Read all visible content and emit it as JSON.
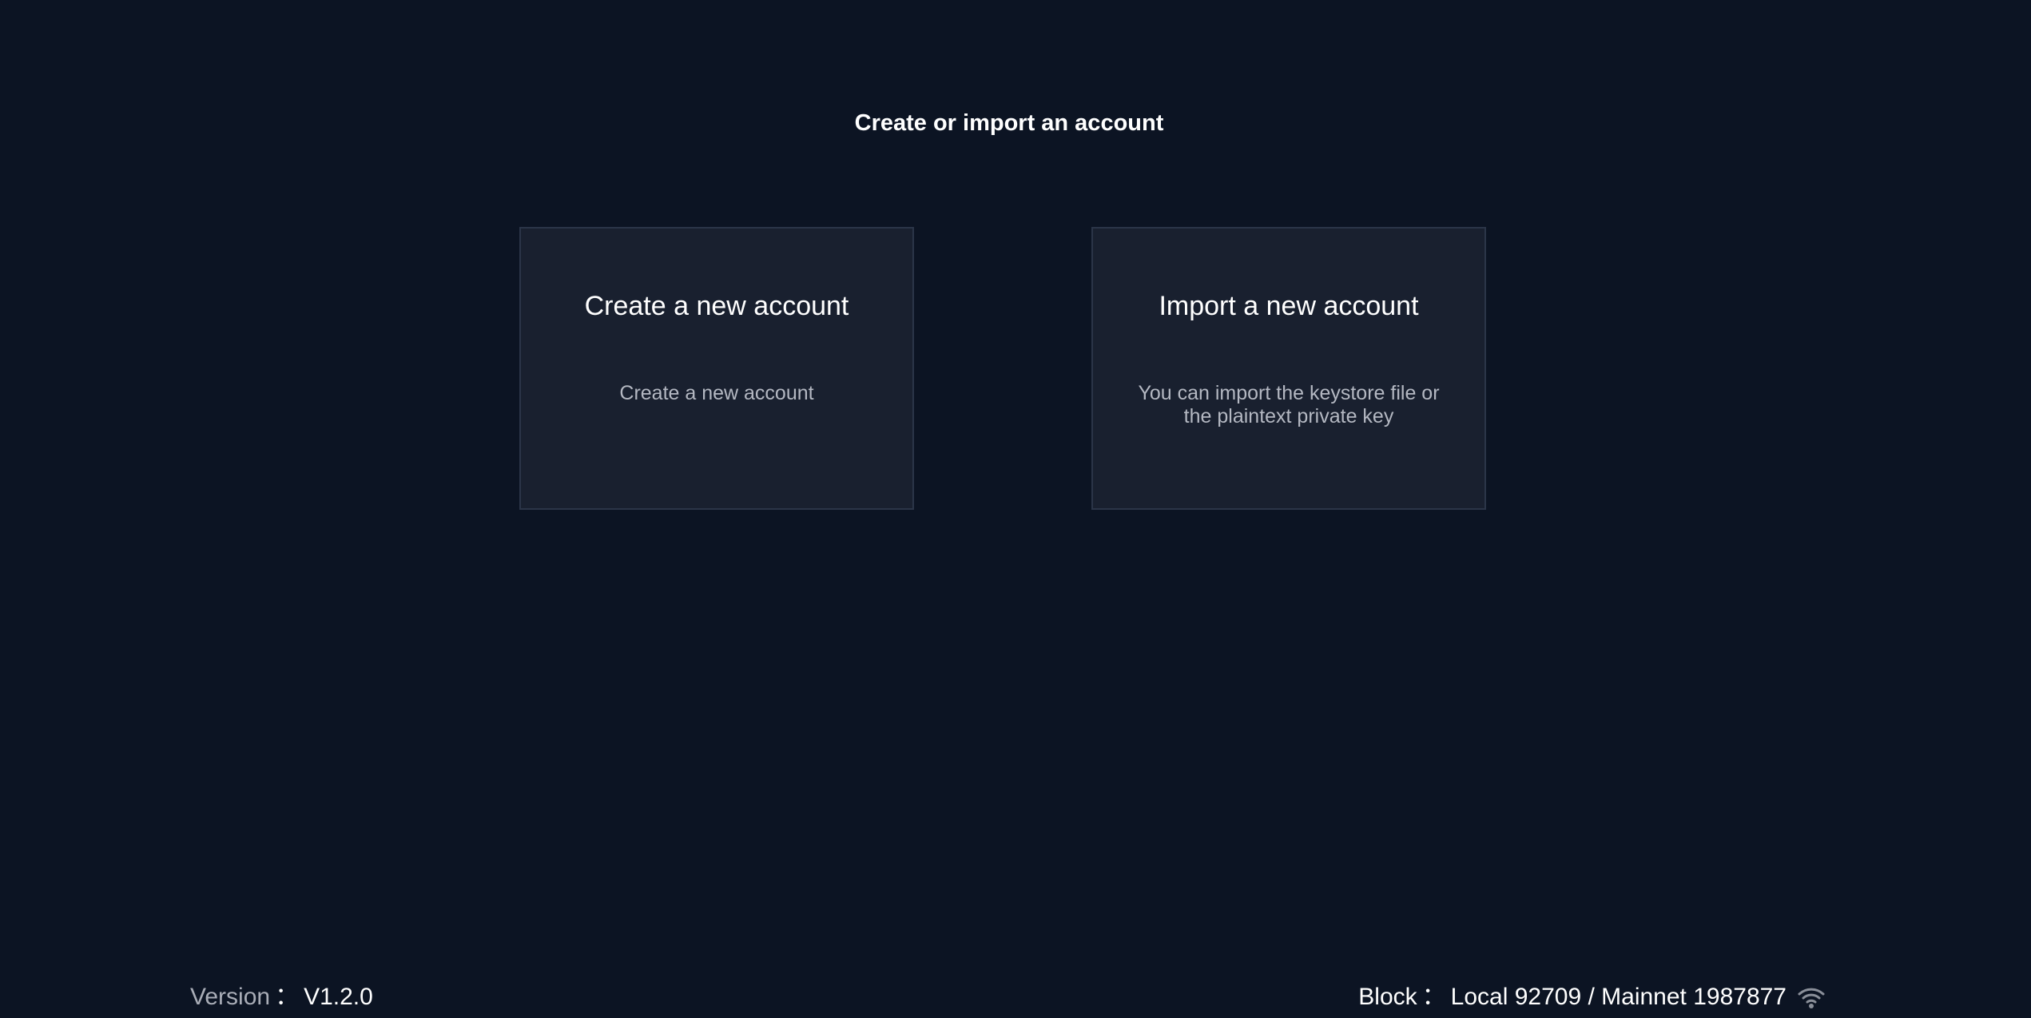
{
  "header": {
    "title": "Create or import an account"
  },
  "cards": {
    "create": {
      "title": "Create a new account",
      "description": "Create a new account"
    },
    "import": {
      "title": "Import a new account",
      "description": "You can import the keystore file or the plaintext private key"
    }
  },
  "footer": {
    "version_label": "Version",
    "separator": "：",
    "version_value": "V1.2.0",
    "block_label": "Block",
    "block_value": "Local 92709 / Mainnet 1987877",
    "status_icon": "wifi-icon"
  }
}
